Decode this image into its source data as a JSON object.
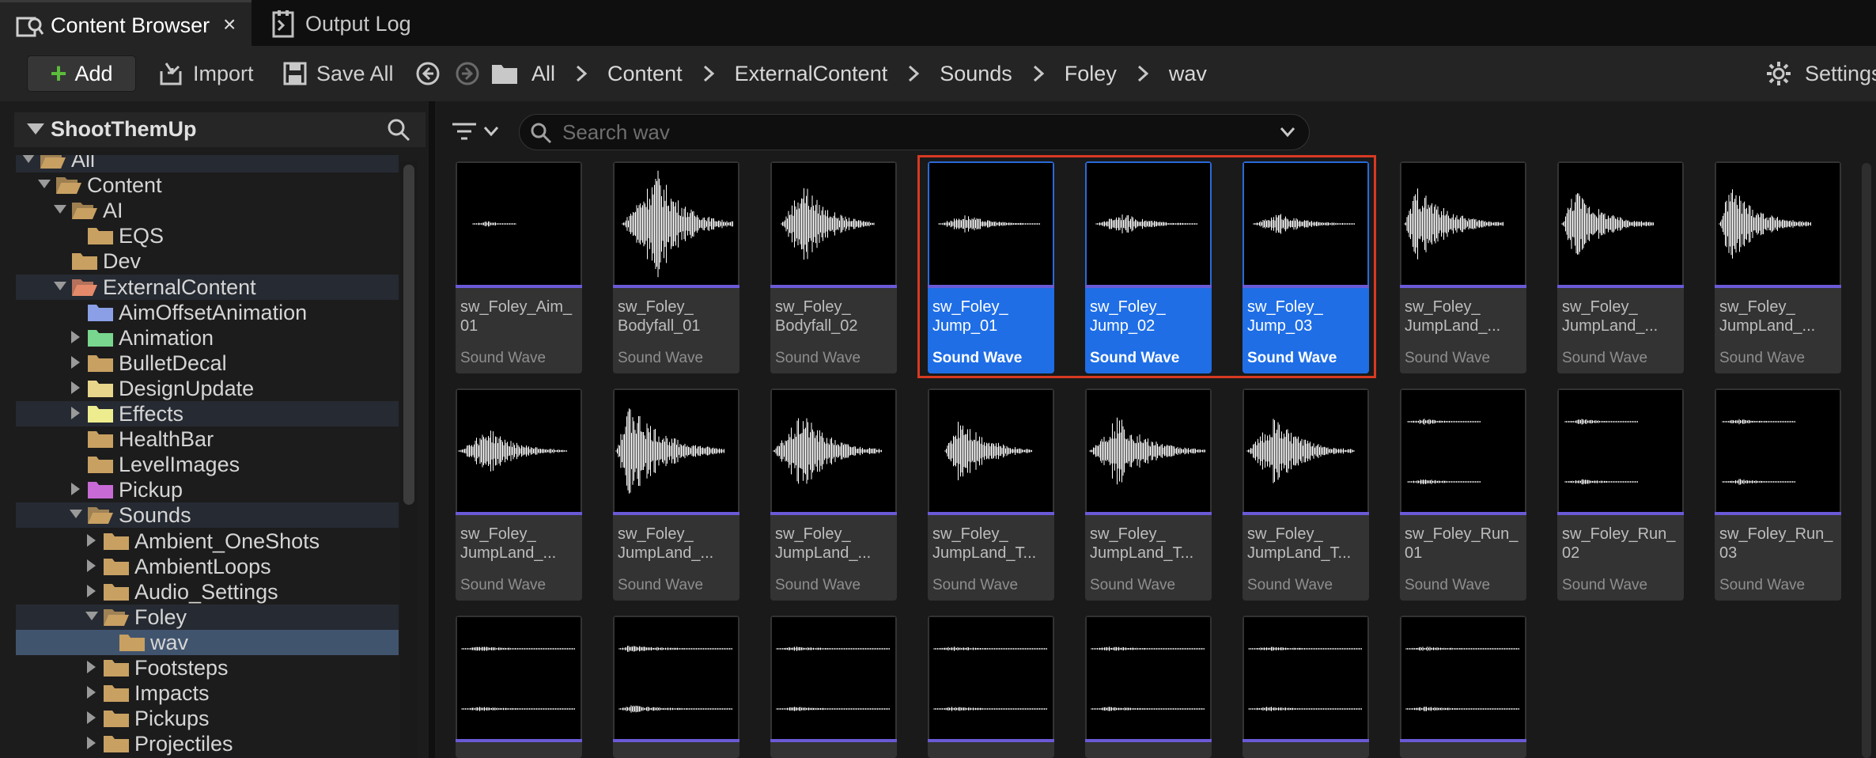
{
  "tabs": {
    "active_label": "Content Browser",
    "close_glyph": "×",
    "second_label": "Output Log"
  },
  "toolbar": {
    "add_label": "Add",
    "import_label": "Import",
    "save_all_label": "Save All",
    "settings_label": "Settings",
    "breadcrumb": [
      "All",
      "Content",
      "ExternalContent",
      "Sounds",
      "Foley",
      "wav"
    ]
  },
  "sidebar": {
    "title": "ShootThemUp",
    "items": [
      {
        "label": "All",
        "depth": 0,
        "expanded": true
      },
      {
        "label": "Content",
        "depth": 1,
        "expanded": true
      },
      {
        "label": "AI",
        "depth": 2,
        "expanded": true
      },
      {
        "label": "EQS",
        "depth": 3
      },
      {
        "label": "Dev",
        "depth": 2
      },
      {
        "label": "ExternalContent",
        "depth": 2,
        "expanded": true
      },
      {
        "label": "AimOffsetAnimation",
        "depth": 3
      },
      {
        "label": "Animation",
        "depth": 3,
        "collapsed": true
      },
      {
        "label": "BulletDecal",
        "depth": 3,
        "collapsed": true
      },
      {
        "label": "DesignUpdate",
        "depth": 3,
        "collapsed": true
      },
      {
        "label": "Effects",
        "depth": 3,
        "collapsed": true
      },
      {
        "label": "HealthBar",
        "depth": 3
      },
      {
        "label": "LevelImages",
        "depth": 3
      },
      {
        "label": "Pickup",
        "depth": 3,
        "collapsed": true
      },
      {
        "label": "Sounds",
        "depth": 3,
        "expanded": true
      },
      {
        "label": "Ambient_OneShots",
        "depth": 4,
        "collapsed": true
      },
      {
        "label": "AmbientLoops",
        "depth": 4,
        "collapsed": true
      },
      {
        "label": "Audio_Settings",
        "depth": 4,
        "collapsed": true
      },
      {
        "label": "Foley",
        "depth": 4,
        "expanded": true
      },
      {
        "label": "wav",
        "depth": 5
      },
      {
        "label": "Footsteps",
        "depth": 4,
        "collapsed": true
      },
      {
        "label": "Impacts",
        "depth": 4,
        "collapsed": true
      },
      {
        "label": "Pickups",
        "depth": 4,
        "collapsed": true
      },
      {
        "label": "Projectiles",
        "depth": 4,
        "collapsed": true
      }
    ]
  },
  "search": {
    "placeholder": "Search wav"
  },
  "assets": [
    {
      "name": "sw_Foley_Aim_\n01",
      "type": "Sound Wave",
      "selected": false
    },
    {
      "name": "sw_Foley_\nBodyfall_01",
      "type": "Sound Wave",
      "selected": false
    },
    {
      "name": "sw_Foley_\nBodyfall_02",
      "type": "Sound Wave",
      "selected": false
    },
    {
      "name": "sw_Foley_\nJump_01",
      "type": "Sound Wave",
      "selected": true
    },
    {
      "name": "sw_Foley_\nJump_02",
      "type": "Sound Wave",
      "selected": true
    },
    {
      "name": "sw_Foley_\nJump_03",
      "type": "Sound Wave",
      "selected": true
    },
    {
      "name": "sw_Foley_\nJumpLand_...",
      "type": "Sound Wave",
      "selected": false
    },
    {
      "name": "sw_Foley_\nJumpLand_...",
      "type": "Sound Wave",
      "selected": false
    },
    {
      "name": "sw_Foley_\nJumpLand_...",
      "type": "Sound Wave",
      "selected": false
    },
    {
      "name": "sw_Foley_\nJumpLand_...",
      "type": "Sound Wave",
      "selected": false
    },
    {
      "name": "sw_Foley_\nJumpLand_...",
      "type": "Sound Wave",
      "selected": false
    },
    {
      "name": "sw_Foley_\nJumpLand_...",
      "type": "Sound Wave",
      "selected": false
    },
    {
      "name": "sw_Foley_\nJumpLand_T...",
      "type": "Sound Wave",
      "selected": false
    },
    {
      "name": "sw_Foley_\nJumpLand_T...",
      "type": "Sound Wave",
      "selected": false
    },
    {
      "name": "sw_Foley_\nJumpLand_T...",
      "type": "Sound Wave",
      "selected": false
    },
    {
      "name": "sw_Foley_Run_\n01",
      "type": "Sound Wave",
      "selected": false
    },
    {
      "name": "sw_Foley_Run_\n02",
      "type": "Sound Wave",
      "selected": false
    },
    {
      "name": "sw_Foley_Run_\n03",
      "type": "Sound Wave",
      "selected": false
    },
    {
      "name": "",
      "type": "",
      "selected": false
    },
    {
      "name": "",
      "type": "",
      "selected": false
    },
    {
      "name": "",
      "type": "",
      "selected": false
    },
    {
      "name": "",
      "type": "",
      "selected": false
    },
    {
      "name": "",
      "type": "",
      "selected": false
    },
    {
      "name": "",
      "type": "",
      "selected": false
    },
    {
      "name": "",
      "type": "",
      "selected": false
    }
  ],
  "colors": {
    "selection": "#1f6ee6",
    "asset_bar": "#6a5ad6",
    "highlight": "#d73a22",
    "folder": "#c8a062",
    "add_plus": "#5bbd3a"
  }
}
